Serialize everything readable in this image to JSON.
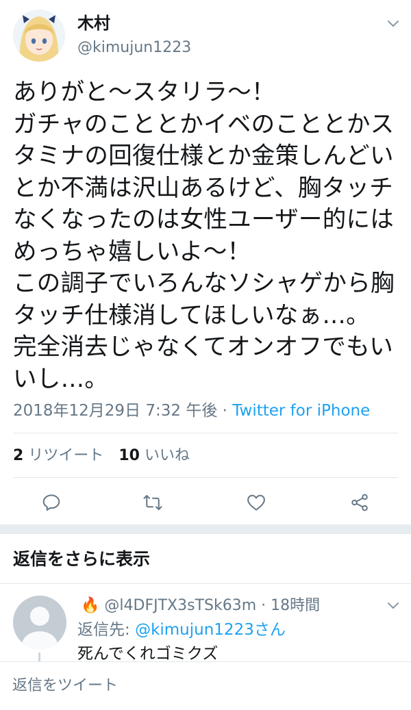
{
  "tweet": {
    "author": {
      "display_name": "木村",
      "handle": "@kimujun1223"
    },
    "text": "ありがと〜スタリラ〜！\nガチャのこととかイベのこととかス\nタミナの回復仕様とか金策しんどい\nとか不満は沢山あるけど、胸タッチ\nなくなったのは女性ユーザー的には\nめっちゃ嬉しいよ〜！\nこの調子でいろんなソシャゲから胸\nタッチ仕様消してほしいなぁ…。\n完全消去じゃなくてオンオフでもい\nいし…。",
    "timestamp": "2018年12月29日 7:32 午後",
    "separator": " · ",
    "source": "Twitter for iPhone",
    "stats": {
      "retweets_count": "2",
      "retweets_label": "リツイート",
      "likes_count": "10",
      "likes_label": "いいね"
    }
  },
  "actions": [
    "reply-icon",
    "retweet-icon",
    "like-icon",
    "share-icon"
  ],
  "more_replies_label": "返信をさらに表示",
  "reply": {
    "badge": "🔥",
    "handle": "@l4DFJTX3sTSk63m",
    "separator": " · ",
    "time": "18時間",
    "reply_to_prefix": "返信先: ",
    "reply_to_mention": "@kimujun1223さん",
    "text": "死んでくれゴミクズ"
  },
  "compose": {
    "placeholder": "返信をツイート"
  },
  "colors": {
    "link": "#1da1f2",
    "secondary": "#657786",
    "text": "#14171a",
    "divider": "#e1e8ed"
  }
}
